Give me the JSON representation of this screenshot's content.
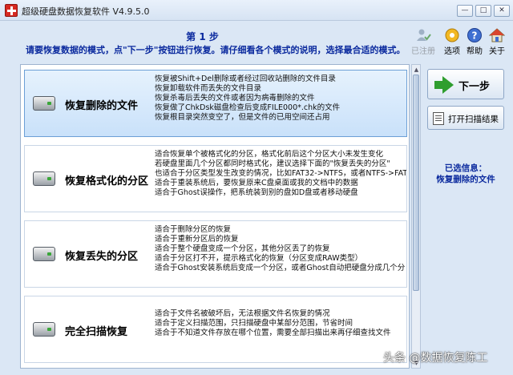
{
  "window": {
    "title": "超级硬盘数据恢复软件 V4.9.5.0",
    "controls": {
      "minimize": "—",
      "restore": "□",
      "close": "✕"
    }
  },
  "header": {
    "step": "第 1 步",
    "instruction": "请要恢复数据的模式，点\"下一步\"按钮进行恢复。请仔细看各个模式的说明，选择最合适的模式。"
  },
  "toolbar": [
    {
      "label": "已注册",
      "icon": "registered-user-icon",
      "enabled": false
    },
    {
      "label": "选项",
      "icon": "gear-icon",
      "enabled": true
    },
    {
      "label": "帮助",
      "icon": "help-icon",
      "enabled": true
    },
    {
      "label": "关于",
      "icon": "home-icon",
      "enabled": true
    }
  ],
  "modes": [
    {
      "title": "恢复删除的文件",
      "selected": true,
      "desc": [
        "恢复被Shift+Del删除或者经过回收站删除的文件目录",
        "恢复卸载软件而丢失的文件目录",
        "恢复杀毒后丢失的文件或者因为病毒删除的文件",
        "恢复做了ChkDsk磁盘检查后变成FILE000*.chk的文件",
        "恢复根目录突然变空了，但是文件的已用空间还占用"
      ]
    },
    {
      "title": "恢复格式化的分区",
      "selected": false,
      "desc": [
        "适合恢复单个被格式化的分区，格式化前后这个分区大小未发生变化",
        "若硬盘里面几个分区都同时格式化，建议选择下面的\"恢复丢失的分区\"",
        "也适合于分区类型发生改变的情况，比如FAT32->NTFS，或者NTFS->FAT3",
        "适合于重装系统后，要恢复原来C盘桌面或我的文档中的数据",
        "适合于Ghost误操作，把系统装到别的盘如D盘或者移动硬盘"
      ]
    },
    {
      "title": "恢复丢失的分区",
      "selected": false,
      "desc": [
        "适合于删除分区的恢复",
        "适合于重新分区后的恢复",
        "适合于整个硬盘变成一个分区，其他分区丢了的恢复",
        "适合于分区打不开，提示格式化的恢复（分区变成RAW类型）",
        "适合于Ghost安装系统后变成一个分区，或者Ghost自动把硬盘分成几个分"
      ]
    },
    {
      "title": "完全扫描恢复",
      "selected": false,
      "desc": [
        "适合于文件名被破坏后，无法根据文件名恢复的情况",
        "适合于定义扫描范围，只扫描硬盘中某部分范围，节省时间",
        "适合于不知道文件存放在哪个位置，需要全部扫描出来再仔细查找文件"
      ]
    }
  ],
  "actions": {
    "next": "下一步",
    "open_scan": "打开扫描结果"
  },
  "selection_info": {
    "label": "已选信息：",
    "value": "恢复删除的文件"
  },
  "watermark": "头条 @数据恢复陈工",
  "colors": {
    "heading_blue": "#0b2a9e",
    "selected_item_bg": "#c9e1fa",
    "next_arrow_green": "#2f9e2f"
  }
}
